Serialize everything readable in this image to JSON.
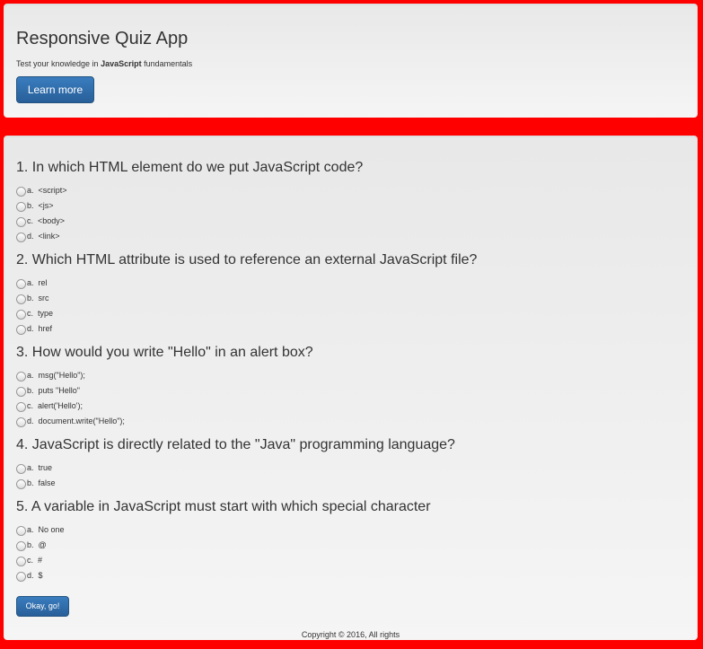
{
  "header": {
    "title": "Responsive Quiz App",
    "subtitle_prefix": "Test your knowledge in ",
    "subtitle_bold": "JavaScript",
    "subtitle_suffix": " fundamentals",
    "learn_more_label": "Learn more"
  },
  "quiz": {
    "questions": [
      {
        "title": "1. In which HTML element do we put JavaScript code?",
        "options": [
          "a.  <script>",
          "b.  <js>",
          "c.  <body>",
          "d.  <link>"
        ]
      },
      {
        "title": "2. Which HTML attribute is used to reference an external JavaScript file?",
        "options": [
          "a.  rel",
          "b.  src",
          "c.  type",
          "d.  href"
        ]
      },
      {
        "title": "3. How would you write \"Hello\" in an alert box?",
        "options": [
          "a.  msg(\"Hello\");",
          "b.  puts \"Hello\"",
          "c.  alert('Hello');",
          "d.  document.write(\"Hello\");"
        ]
      },
      {
        "title": "4. JavaScript is directly related to the \"Java\" programming language?",
        "options": [
          "a.  true",
          "b.  false"
        ]
      },
      {
        "title": "5. A variable in JavaScript must start with which special character",
        "options": [
          "a.  No one",
          "b.  @",
          "c.  #",
          "d.  $"
        ]
      }
    ],
    "submit_label": "Okay, go!",
    "copyright": "Copyright © 2016, All rights"
  }
}
